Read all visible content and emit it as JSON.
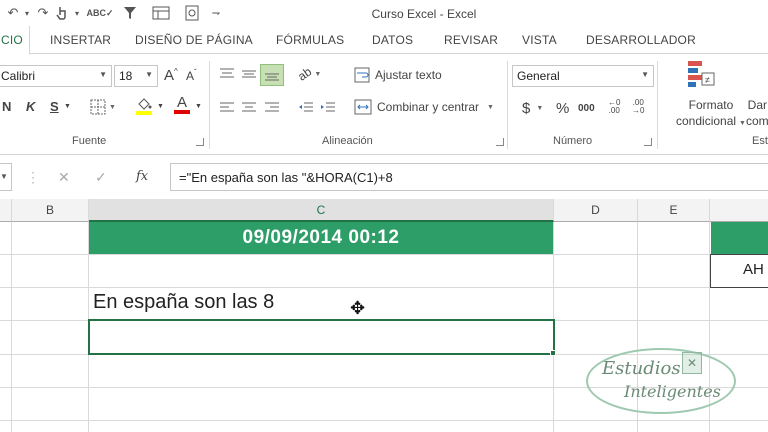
{
  "window": {
    "title": "Curso Excel - Excel"
  },
  "tabs": [
    {
      "label": "CIO",
      "active": true
    },
    {
      "label": "INSERTAR"
    },
    {
      "label": "DISEÑO DE PÁGINA"
    },
    {
      "label": "FÓRMULAS"
    },
    {
      "label": "DATOS"
    },
    {
      "label": "REVISAR"
    },
    {
      "label": "VISTA"
    },
    {
      "label": "DESARROLLADOR"
    }
  ],
  "ribbon": {
    "font": {
      "name": "Calibri",
      "size": "18",
      "bold_label": "N",
      "italic_label": "K",
      "underline_label": "S",
      "group_label": "Fuente"
    },
    "alignment": {
      "wrap_label": "Ajustar texto",
      "merge_label": "Combinar y centrar",
      "group_label": "Alineación"
    },
    "number": {
      "format": "General",
      "currency": "$",
      "percent": "%",
      "thousands": "000",
      "group_label": "Número"
    },
    "styles": {
      "conditional_line1": "Formato",
      "conditional_line2": "condicional",
      "next_line1": "Dar",
      "next_line2": "com",
      "group_label": "Est"
    }
  },
  "formula_bar": {
    "fx": "fx",
    "formula": "=\"En españa son las \"&HORA(C1)+8"
  },
  "columns": [
    "B",
    "C",
    "D",
    "E"
  ],
  "cells": {
    "C1": "09/09/2014 00:12",
    "G2": "AH",
    "C3": "En españa son las 8"
  },
  "watermark": {
    "line1": "Estudios",
    "line2": "Inteligentes"
  },
  "colors": {
    "excel_green": "#217346",
    "header_fill": "#2e9e68"
  }
}
